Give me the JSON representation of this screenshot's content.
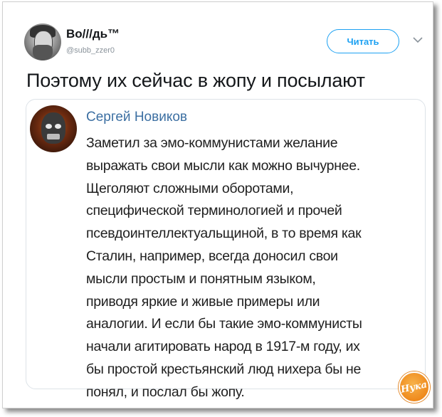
{
  "tweet": {
    "user": {
      "name": "Во///дь™",
      "handle": "@subb_zzer0"
    },
    "follow_label": "Читать",
    "text": "Поэтому их сейчас в жопу и посылают",
    "quoted_post": {
      "author": "Сергей Новиков",
      "lines": [
        "Заметил за эмо-коммунистами желание",
        "выражать свои мысли как можно вычурнее.",
        "Щеголяют сложными оборотами,",
        "специфической терминологией и прочей",
        "псевдоинтеллектуальщиной, в то время как",
        "Сталин, например, всегда доносил свои",
        "мысли простым и понятным языком,",
        "приводя яркие и живые примеры или",
        "аналогии. И если бы такие эмо-коммунисты",
        "начали агитировать народ в 1917-м году, их",
        "бы простой крестьянский люд нихера бы не",
        "понял, и послал бы жопу."
      ]
    }
  },
  "watermark": {
    "text": "Нука",
    "color": "#ef8a1d"
  },
  "colors": {
    "accent": "#1da1f2",
    "author_link": "#3c6fa2"
  }
}
